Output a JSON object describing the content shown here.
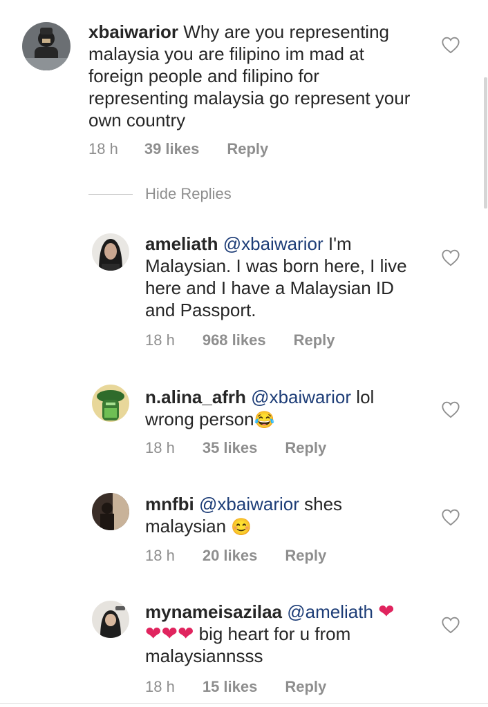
{
  "comments": [
    {
      "username": "xbaiwarior",
      "mention": "",
      "text": "Why are you  representing malaysia you are filipino im mad at foreign people and filipino for representing malaysia go represent your own country",
      "time": "18 h",
      "likes": "39 likes",
      "reply": "Reply"
    },
    {
      "username": "ameliath",
      "mention": "@xbaiwarior",
      "text": "I'm Malaysian. I was born here, I live here and I have a Malaysian ID and Passport.",
      "time": "18 h",
      "likes": "968 likes",
      "reply": "Reply"
    },
    {
      "username": "n.alina_afrh",
      "mention": "@xbaiwarior",
      "text": "lol wrong person",
      "emoji": "😂",
      "time": "18 h",
      "likes": "35 likes",
      "reply": "Reply"
    },
    {
      "username": "mnfbi",
      "mention": "@xbaiwarior",
      "text": "shes malaysian",
      "emoji": "😊",
      "time": "18 h",
      "likes": "20 likes",
      "reply": "Reply"
    },
    {
      "username": "mynameisazilaa",
      "mention": "@ameliath",
      "heart_emoji": "❤",
      "text": "big heart for u from malaysiannsss",
      "time": "18 h",
      "likes": "15 likes",
      "reply": "Reply"
    }
  ],
  "hide_replies": "Hide Replies",
  "icons": {
    "like": "heart-outline-icon"
  },
  "colors": {
    "mention": "#1d3d77",
    "meta": "#8e8e8e",
    "heart_red": "#e0245e"
  }
}
